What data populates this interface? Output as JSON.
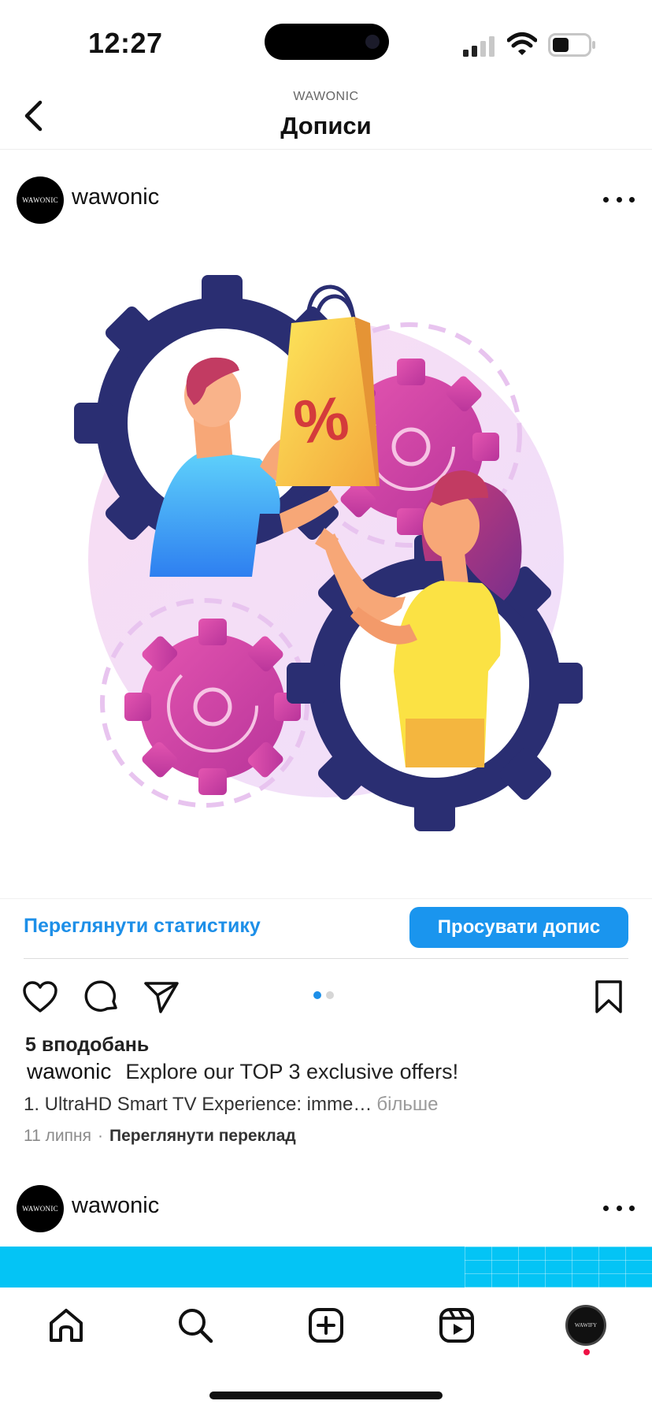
{
  "status_bar": {
    "time": "12:27"
  },
  "nav": {
    "subtitle": "WAWONIC",
    "title": "Дописи"
  },
  "post1": {
    "username": "wawonic",
    "avatar_text": "WAWONIC",
    "image_sign": "%",
    "stats_link": "Переглянути статистику",
    "promote_button": "Просувати допис",
    "likes": "5 вподобань",
    "caption_user": "wawonic",
    "caption_text": "Explore our TOP 3 exclusive offers!",
    "caption_line2": "1. UltraHD Smart TV Experience: imme…",
    "more_label": "більше",
    "date": "11 липня",
    "separator": "·",
    "translate_label": "Переглянути переклад",
    "carousel": {
      "count": 2,
      "active": 1
    }
  },
  "post2": {
    "username": "wawonic",
    "avatar_text": "WAWONIC",
    "image_color": "#04c4f5"
  },
  "tabbar": {
    "icons": [
      "home-icon",
      "search-icon",
      "create-icon",
      "reels-icon",
      "profile-avatar"
    ],
    "profile_avatar_text": "WAWIFY"
  },
  "colors": {
    "link_blue": "#1d8fe8",
    "button_blue": "#1a95ee",
    "notification_red": "#ee1144"
  }
}
